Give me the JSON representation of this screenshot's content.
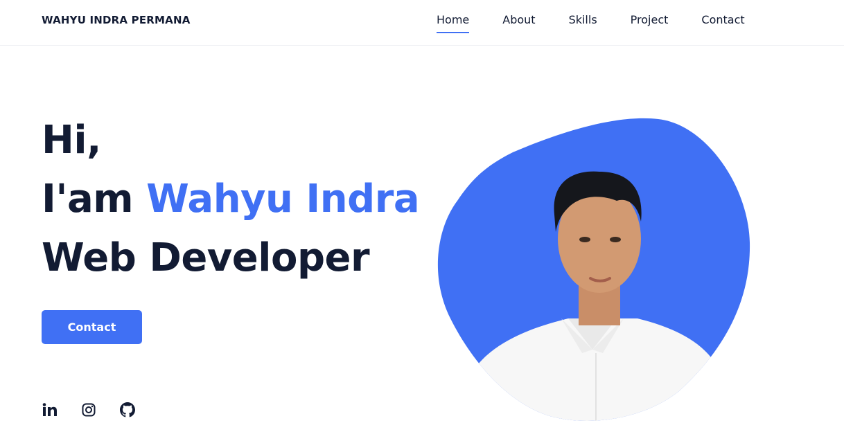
{
  "header": {
    "logo": "WAHYU INDRA PERMANA",
    "nav": [
      {
        "label": "Home",
        "active": true
      },
      {
        "label": "About",
        "active": false
      },
      {
        "label": "Skills",
        "active": false
      },
      {
        "label": "Project",
        "active": false
      },
      {
        "label": "Contact",
        "active": false
      }
    ]
  },
  "hero": {
    "greeting": "Hi,",
    "intro_prefix": "I'am",
    "name": "Wahyu Indra",
    "role": "Web Developer",
    "cta_label": "Contact"
  },
  "socials": [
    {
      "name": "linkedin-icon"
    },
    {
      "name": "instagram-icon"
    },
    {
      "name": "github-icon"
    }
  ],
  "colors": {
    "accent": "#4070f4",
    "text": "#121b33",
    "background": "#ffffff"
  }
}
